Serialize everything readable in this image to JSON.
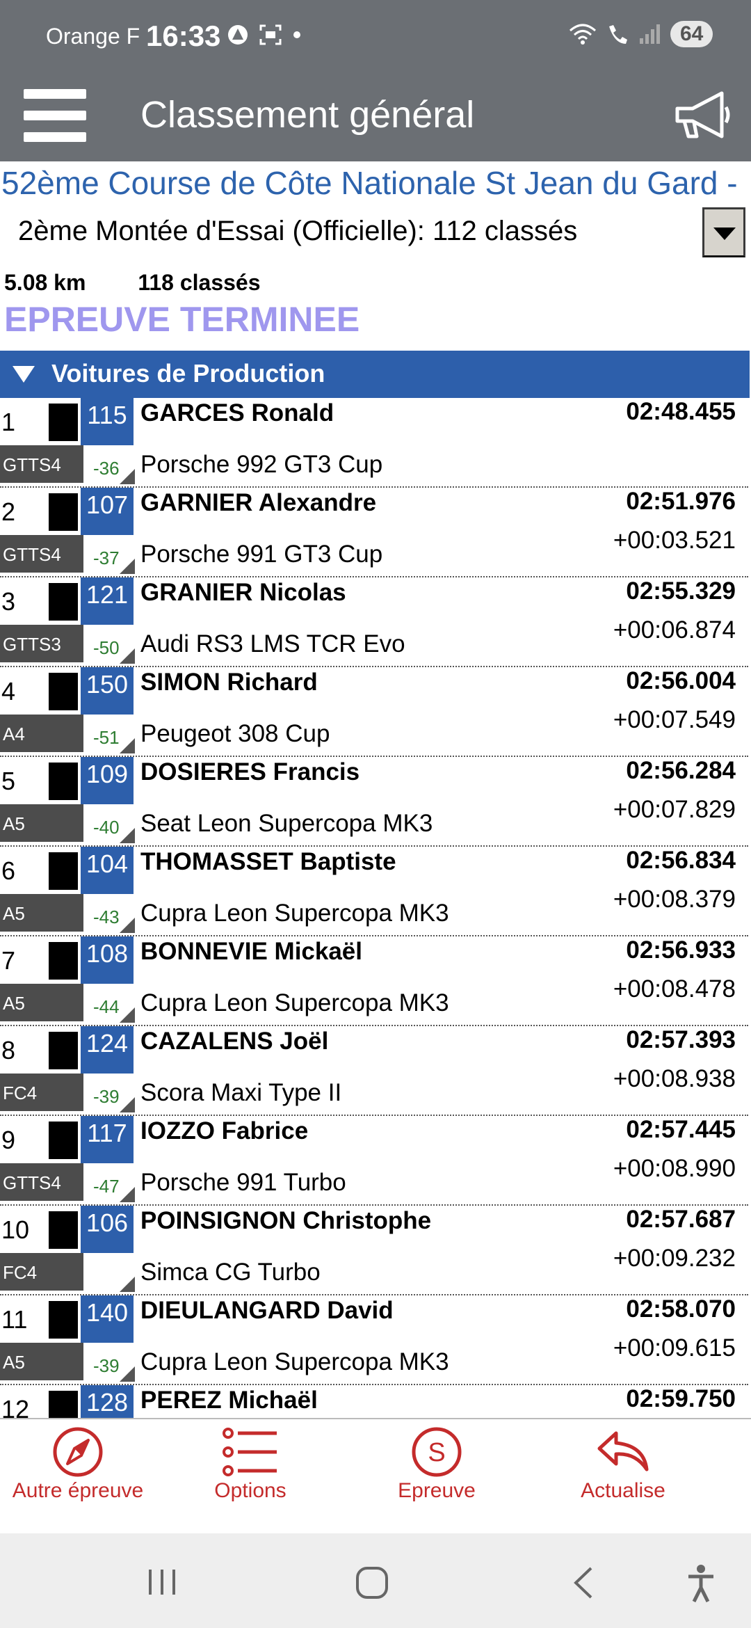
{
  "status_bar": {
    "carrier": "Orange F",
    "time": "16:33",
    "battery": "64",
    "icons": [
      "alert-icon",
      "screenshot-icon",
      "dot-icon",
      "wifi-icon",
      "wifi-call-icon",
      "signal-icon",
      "battery-icon"
    ]
  },
  "app_bar": {
    "title": "Classement général",
    "menu_icon": "hamburger-icon",
    "action_icon": "megaphone-icon"
  },
  "event": {
    "title": "52ème Course de Côte Nationale St Jean du Gard -",
    "run_selector": "2ème Montée d'Essai (Officielle): 112 classés",
    "distance": "5.08 km",
    "classified": "118 classés",
    "status": "EPREUVE TERMINEE"
  },
  "category": {
    "label": "Voitures de Production"
  },
  "colors": {
    "accent_blue": "#2d5fab",
    "topbar_gray": "#6b6f74",
    "status_purple": "#9f97ee",
    "nav_red": "#c42b2b",
    "delta_green": "#2e7d32"
  },
  "results": [
    {
      "pos": "1",
      "num": "115",
      "cls": "GTTS4",
      "delta": "-36",
      "driver": "GARCES Ronald",
      "car": "Porsche 992 GT3 Cup",
      "time": "02:48.455",
      "gap": ""
    },
    {
      "pos": "2",
      "num": "107",
      "cls": "GTTS4",
      "delta": "-37",
      "driver": "GARNIER Alexandre",
      "car": "Porsche 991 GT3 Cup",
      "time": "02:51.976",
      "gap": "+00:03.521"
    },
    {
      "pos": "3",
      "num": "121",
      "cls": "GTTS3",
      "delta": "-50",
      "driver": "GRANIER Nicolas",
      "car": "Audi RS3 LMS TCR Evo",
      "time": "02:55.329",
      "gap": "+00:06.874"
    },
    {
      "pos": "4",
      "num": "150",
      "cls": "A4",
      "delta": "-51",
      "driver": "SIMON Richard",
      "car": "Peugeot 308 Cup",
      "time": "02:56.004",
      "gap": "+00:07.549"
    },
    {
      "pos": "5",
      "num": "109",
      "cls": "A5",
      "delta": "-40",
      "driver": "DOSIERES Francis",
      "car": "Seat Leon Supercopa MK3",
      "time": "02:56.284",
      "gap": "+00:07.829"
    },
    {
      "pos": "6",
      "num": "104",
      "cls": "A5",
      "delta": "-43",
      "driver": "THOMASSET Baptiste",
      "car": "Cupra Leon Supercopa MK3",
      "time": "02:56.834",
      "gap": "+00:08.379"
    },
    {
      "pos": "7",
      "num": "108",
      "cls": "A5",
      "delta": "-44",
      "driver": "BONNEVIE Mickaël",
      "car": "Cupra Leon Supercopa MK3",
      "time": "02:56.933",
      "gap": "+00:08.478"
    },
    {
      "pos": "8",
      "num": "124",
      "cls": "FC4",
      "delta": "-39",
      "driver": "CAZALENS Joël",
      "car": "Scora Maxi Type II",
      "time": "02:57.393",
      "gap": "+00:08.938"
    },
    {
      "pos": "9",
      "num": "117",
      "cls": "GTTS4",
      "delta": "-47",
      "driver": "IOZZO Fabrice",
      "car": "Porsche 991 Turbo",
      "time": "02:57.445",
      "gap": "+00:08.990"
    },
    {
      "pos": "10",
      "num": "106",
      "cls": "FC4",
      "delta": "",
      "driver": "POINSIGNON Christophe",
      "car": "Simca CG Turbo",
      "time": "02:57.687",
      "gap": "+00:09.232"
    },
    {
      "pos": "11",
      "num": "140",
      "cls": "A5",
      "delta": "-39",
      "driver": "DIEULANGARD David",
      "car": "Cupra Leon Supercopa MK3",
      "time": "02:58.070",
      "gap": "+00:09.615"
    },
    {
      "pos": "12",
      "num": "128",
      "cls": "",
      "delta": "",
      "driver": "PEREZ Michaël",
      "car": "",
      "time": "02:59.750",
      "gap": ""
    }
  ],
  "bottom_nav": [
    {
      "label": "Autre épreuve",
      "icon": "compass-icon"
    },
    {
      "label": "Options",
      "icon": "list-icon"
    },
    {
      "label": "Epreuve",
      "icon": "s-circle-icon"
    },
    {
      "label": "Actualise",
      "icon": "reply-arrow-icon"
    }
  ],
  "system_nav": [
    "recents-icon",
    "home-icon",
    "back-icon",
    "accessibility-icon"
  ]
}
